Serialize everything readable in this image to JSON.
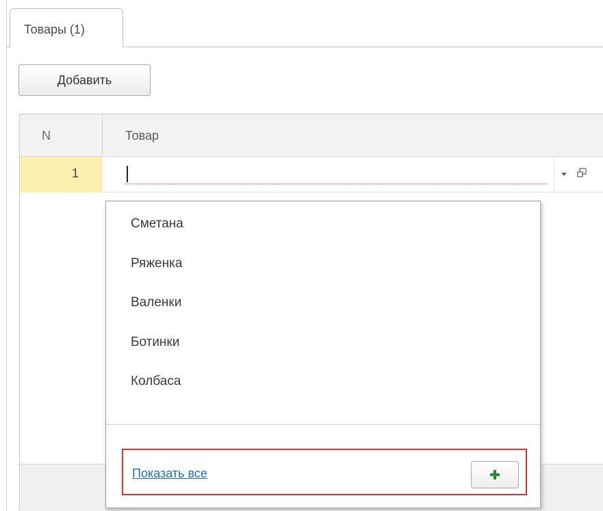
{
  "tab": {
    "label": "Товары (1)"
  },
  "toolbar": {
    "add_label": "Добавить"
  },
  "table": {
    "columns": [
      "N",
      "Товар"
    ],
    "row": {
      "n": "1",
      "value": ""
    }
  },
  "dropdown": {
    "items": [
      "Сметана",
      "Ряженка",
      "Валенки",
      "Ботинки",
      "Колбаса"
    ],
    "show_all_label": "Показать все",
    "create_icon": "plus-icon"
  },
  "colors": {
    "selected_row": "#fbf0ae",
    "link": "#1f6fbf",
    "highlight_border": "#e03030",
    "plus": "#2e8b2e"
  }
}
